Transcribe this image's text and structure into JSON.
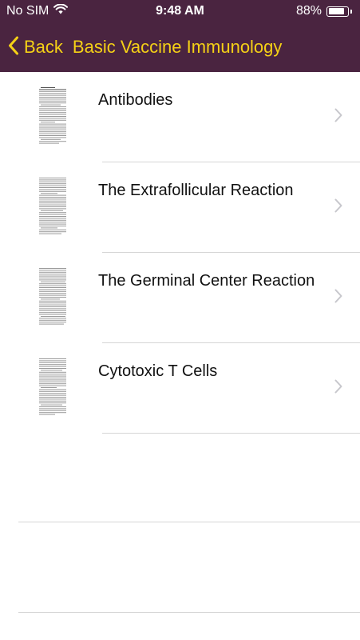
{
  "status_bar": {
    "carrier": "No SIM",
    "time": "9:48 AM",
    "battery_percent": "88%",
    "battery_level": 0.88,
    "wifi_icon": "wifi-icon"
  },
  "nav": {
    "back_label": "Back",
    "title": "Basic Vaccine Immunology",
    "back_icon": "chevron-left-icon"
  },
  "list": {
    "items": [
      {
        "title": "Antibodies"
      },
      {
        "title": "The Extrafollicular Reaction"
      },
      {
        "title": "The Germinal Center Reaction"
      },
      {
        "title": "Cytotoxic T Cells"
      }
    ]
  },
  "colors": {
    "header_bg": "#4a2440",
    "accent": "#f5d116",
    "divider": "#d6d6d6",
    "chevron": "#c7c7cc"
  }
}
